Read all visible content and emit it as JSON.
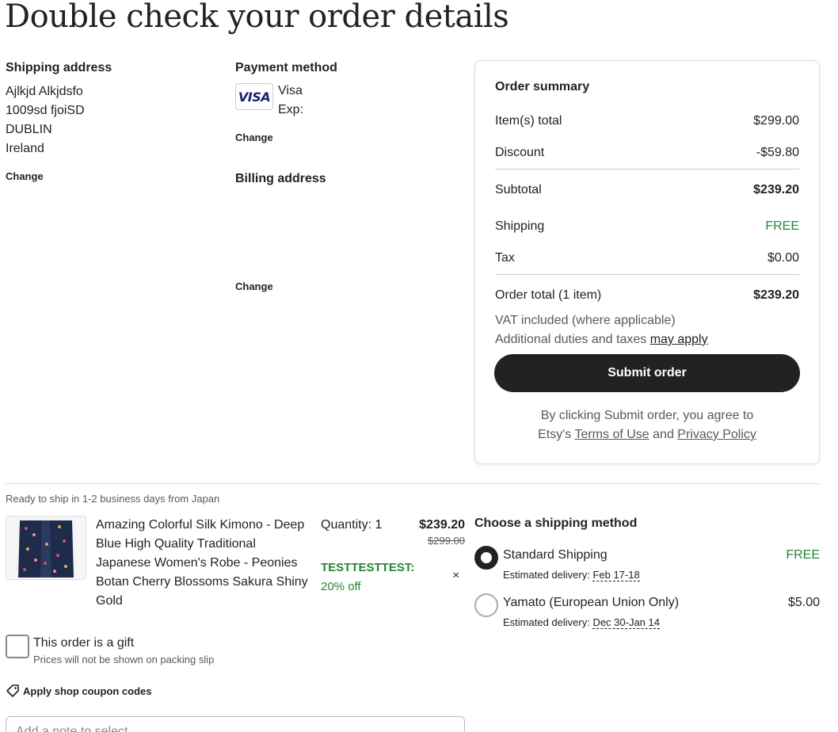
{
  "page_title": "Double check your order details",
  "shipping_address": {
    "heading": "Shipping address",
    "lines": [
      "Ajlkjd Alkjdsfo",
      "1009sd fjoiSD",
      "DUBLIN",
      "Ireland"
    ],
    "change_label": "Change"
  },
  "payment_method": {
    "heading": "Payment method",
    "card_logo_text": "VISA",
    "card_brand": "Visa",
    "exp_label": "Exp:",
    "change_label": "Change"
  },
  "billing_address": {
    "heading": "Billing address",
    "change_label": "Change"
  },
  "order_summary": {
    "title": "Order summary",
    "items_total_label": "Item(s) total",
    "items_total_value": "$299.00",
    "discount_label": "Discount",
    "discount_value": "-$59.80",
    "subtotal_label": "Subtotal",
    "subtotal_value": "$239.20",
    "shipping_label": "Shipping",
    "shipping_value": "FREE",
    "tax_label": "Tax",
    "tax_value": "$0.00",
    "order_total_label": "Order total (1 item)",
    "order_total_value": "$239.20",
    "vat_note": "VAT included (where applicable)",
    "duties_note": "Additional duties and taxes ",
    "duties_link": "may apply",
    "submit_label": "Submit order",
    "agree_prefix": "By clicking Submit order, you agree to",
    "agree_etsy": "Etsy's ",
    "terms_link": "Terms of Use",
    "agree_and": " and ",
    "privacy_link": "Privacy Policy"
  },
  "item": {
    "ready_text": "Ready to ship in 1-2 business days from Japan",
    "title": "Amazing Colorful Silk Kimono - Deep Blue High Quality Traditional Japanese Women's Robe - Peonies Botan Cherry Blossoms Sakura Shiny Gold",
    "quantity": "Quantity: 1",
    "price": "$239.20",
    "original_price": "$299.00",
    "coupon_code": "TESTTESTTEST:",
    "coupon_discount": "20% off",
    "remove_icon": "×"
  },
  "gift": {
    "label": "This order is a gift",
    "sub": "Prices will not be shown on packing slip"
  },
  "apply_coupon_label": "Apply shop coupon codes",
  "note_placeholder": "Add a note to select...",
  "shipping_methods": {
    "title": "Choose a shipping method",
    "options": [
      {
        "name": "Standard Shipping",
        "price": "FREE",
        "est_label": "Estimated delivery: ",
        "est_date": "Feb 17-18",
        "selected": true
      },
      {
        "name": "Yamato (European Union Only)",
        "price": "$5.00",
        "est_label": "Estimated delivery: ",
        "est_date": "Dec 30-Jan 14",
        "selected": false
      }
    ]
  },
  "colors": {
    "accent_green": "#258635",
    "button_dark": "#222222",
    "visa_blue": "#1a1f71"
  }
}
